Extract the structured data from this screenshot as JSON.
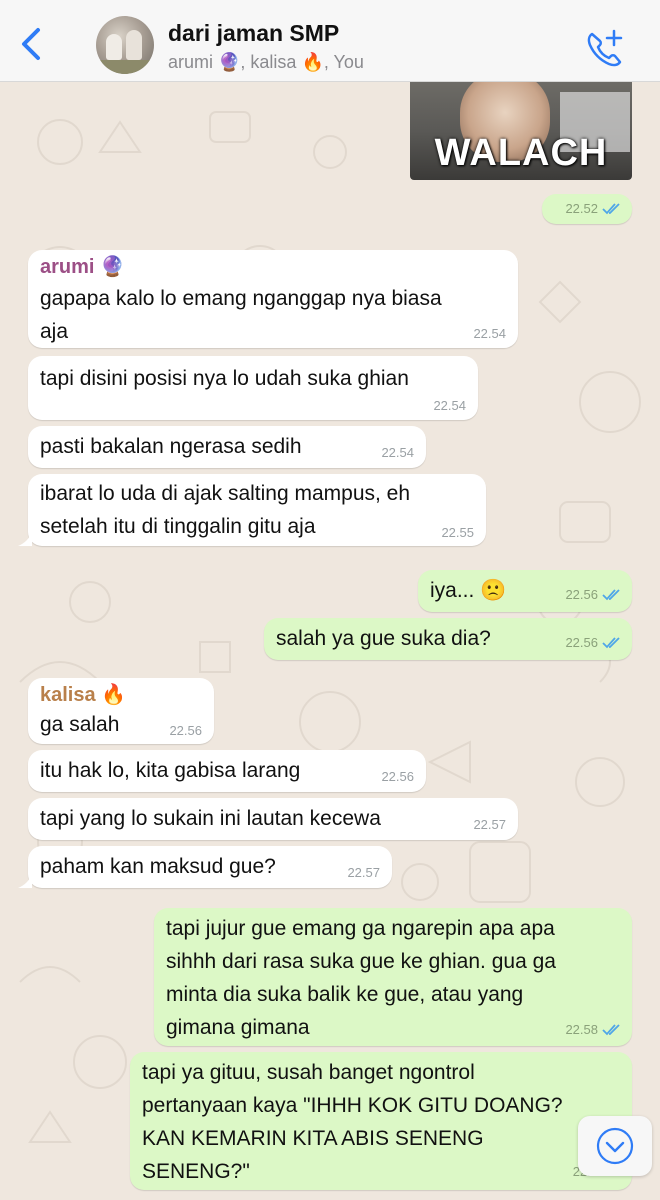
{
  "header": {
    "back_icon": "chevron-left-icon",
    "title": "dari jaman SMP",
    "subtitle": "arumi 🔮, kalisa 🔥, You",
    "call_icon": "add-call-icon",
    "accent": "#2f7cf6"
  },
  "photo": {
    "caption": "WALACH",
    "time": "22.52"
  },
  "messages": [
    {
      "sender": "arumi 🔮",
      "text": "gapapa kalo lo emang nganggap nya biasa\naja",
      "time": "22.54"
    },
    {
      "text": "tapi disini posisi nya lo udah suka ghian",
      "time": "22.54"
    },
    {
      "text": "pasti bakalan ngerasa sedih",
      "time": "22.54"
    },
    {
      "text": "ibarat lo uda di ajak salting mampus, eh\nsetelah itu di tinggalin gitu aja",
      "time": "22.55"
    },
    {
      "text": "iya... 🙁",
      "time": "22.56"
    },
    {
      "text": "salah ya gue suka dia?",
      "time": "22.56"
    },
    {
      "sender": "kalisa 🔥",
      "text": "ga salah",
      "time": "22.56"
    },
    {
      "text": "itu hak lo, kita gabisa larang",
      "time": "22.56"
    },
    {
      "text": "tapi yang lo sukain ini lautan kecewa",
      "time": "22.57"
    },
    {
      "text": "paham kan maksud gue?",
      "time": "22.57"
    },
    {
      "text": "tapi jujur gue emang ga ngarepin apa apa\nsihhh dari rasa suka gue ke ghian. gua ga\nminta dia suka balik ke gue, atau yang\ngimana gimana",
      "time": "22.58"
    },
    {
      "text": "tapi ya gituu, susah banget ngontrol\npertanyaan kaya \"IHHH KOK GITU DOANG?\nKAN KEMARIN KITA ABIS SENENG\nSENENG?\"",
      "time": "22.5"
    }
  ],
  "colors": {
    "arumi": "#9c4f86",
    "kalisa": "#b9804b",
    "incoming": "#ffffff",
    "outgoing": "#dcf8c6",
    "read_ticks": "#4fa6e8"
  },
  "scroll_down_icon": "chevron-down-circle-icon"
}
